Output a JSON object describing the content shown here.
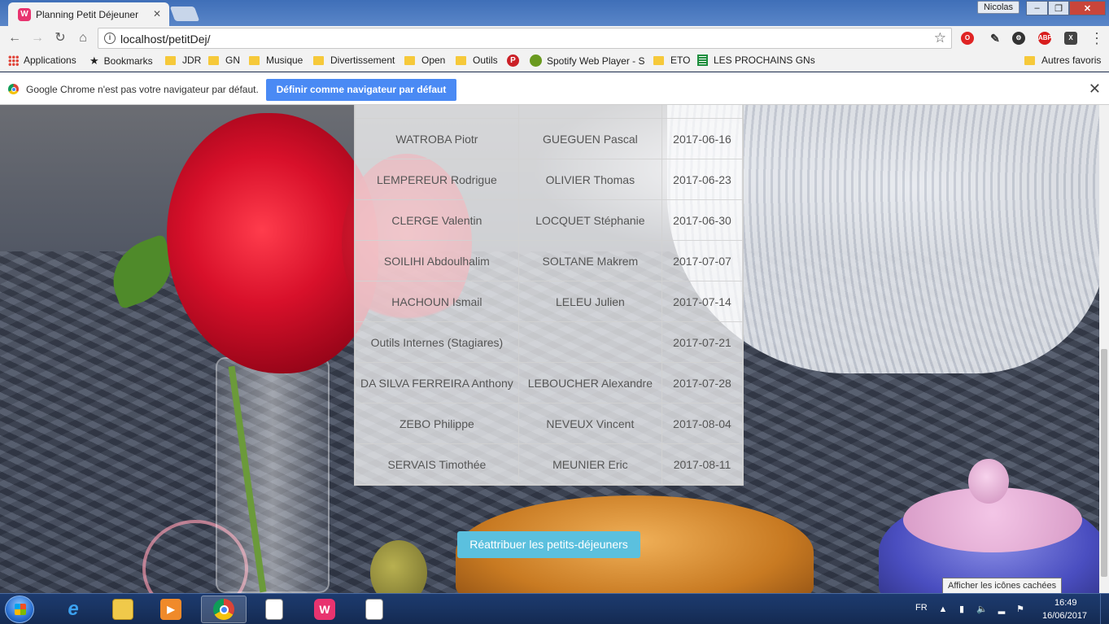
{
  "browser": {
    "tab_title": "Planning Petit Déjeuner",
    "tab_favicon": "W",
    "tab_close": "✕",
    "user_label": "Nicolas",
    "url": "localhost/petitDej/",
    "extension_labels": [
      "ABP",
      "X"
    ]
  },
  "bookmarks": {
    "apps": "Applications",
    "items": [
      "Bookmarks",
      "JDR",
      "GN",
      "Musique",
      "Divertissement",
      "Open",
      "Outils",
      "Spotify Web Player - S",
      "ETO",
      "LES PROCHAINS GNs"
    ],
    "other": "Autres favoris"
  },
  "infobar": {
    "message": "Google Chrome n'est pas votre navigateur par défaut.",
    "button": "Définir comme navigateur par défaut",
    "close": "✕"
  },
  "schedule": {
    "rows": [
      {
        "person1": "WATROBA Piotr",
        "person2": "GUEGUEN Pascal",
        "date": "2017-06-16"
      },
      {
        "person1": "LEMPEREUR Rodrigue",
        "person2": "OLIVIER Thomas",
        "date": "2017-06-23"
      },
      {
        "person1": "CLERGE Valentin",
        "person2": "LOCQUET Stéphanie",
        "date": "2017-06-30"
      },
      {
        "person1": "SOILIHI Abdoulhalim",
        "person2": "SOLTANE Makrem",
        "date": "2017-07-07"
      },
      {
        "person1": "HACHOUN Ismail",
        "person2": "LELEU Julien",
        "date": "2017-07-14"
      },
      {
        "person1": "Outils Internes (Stagiares)",
        "person2": "",
        "date": "2017-07-21"
      },
      {
        "person1": "DA SILVA FERREIRA Anthony",
        "person2": "LEBOUCHER Alexandre",
        "date": "2017-07-28"
      },
      {
        "person1": "ZEBO Philippe",
        "person2": "NEVEUX Vincent",
        "date": "2017-08-04"
      },
      {
        "person1": "SERVAIS Timothée",
        "person2": "MEUNIER Eric",
        "date": "2017-08-11"
      }
    ],
    "reassign_button": "Réattribuer les petits-déjeuners"
  },
  "taskbar": {
    "tooltip": "Afficher les icônes cachées",
    "lang": "FR",
    "time": "16:49",
    "date": "16/06/2017"
  },
  "colors": {
    "accent_button": "#5bc0de",
    "chrome_default_button": "#4a8af4"
  }
}
